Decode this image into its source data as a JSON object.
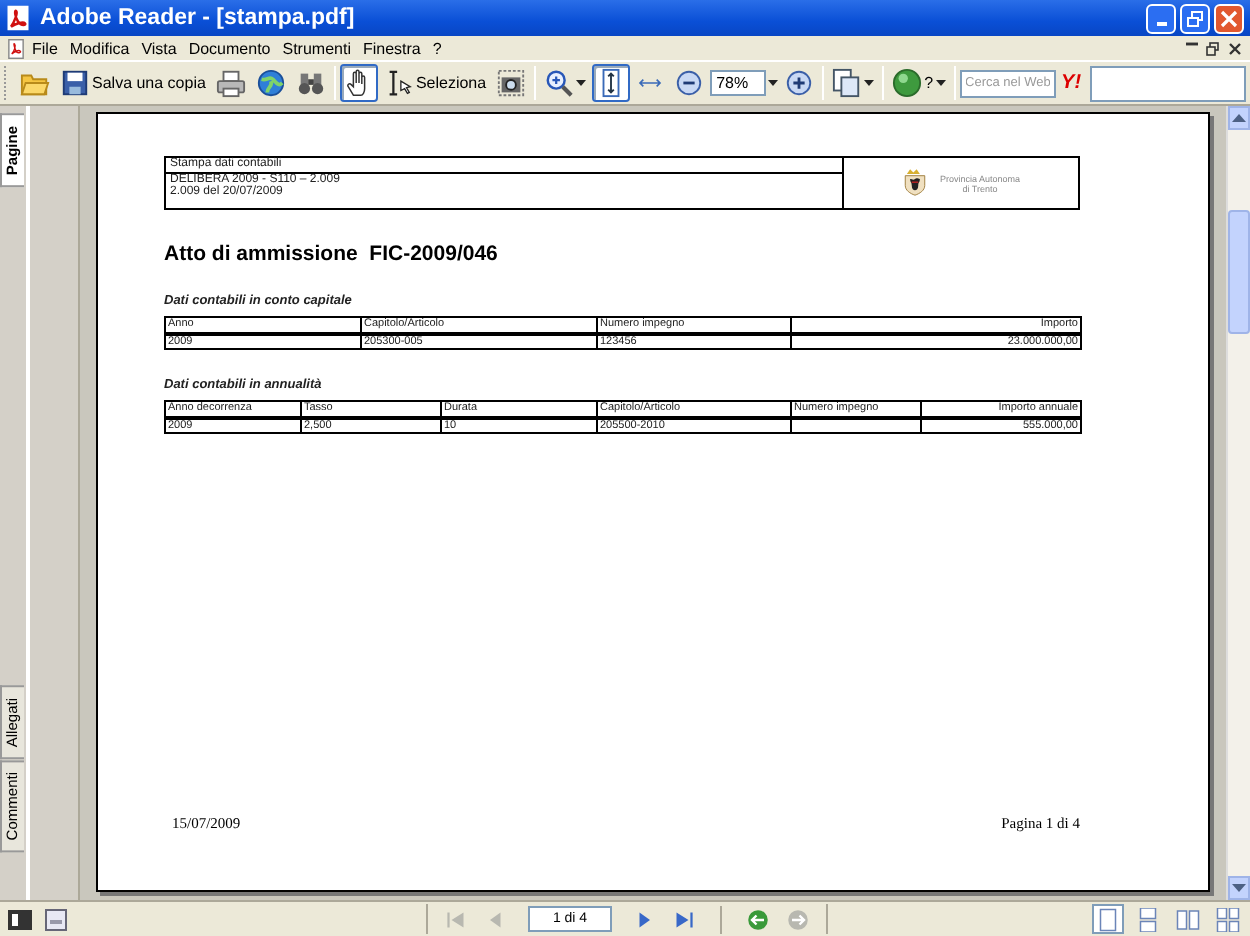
{
  "window": {
    "title": "Adobe Reader - [stampa.pdf]"
  },
  "menu": [
    "File",
    "Modifica",
    "Vista",
    "Documento",
    "Strumenti",
    "Finestra",
    "?"
  ],
  "toolbar": [
    [
      {
        "kind": "open",
        "pressed": false,
        "dropdown": false
      },
      {
        "kind": "save",
        "label": "Salva una copia",
        "pressed": false,
        "dropdown": false
      },
      {
        "kind": "print",
        "pressed": false,
        "dropdown": false
      },
      {
        "kind": "web",
        "pressed": false,
        "dropdown": false
      },
      {
        "kind": "find",
        "pressed": false,
        "dropdown": false
      }
    ],
    [
      {
        "kind": "hand",
        "pressed": true,
        "dropdown": false
      },
      {
        "kind": "select",
        "label": "Seleziona",
        "pressed": false,
        "dropdown": false
      },
      {
        "kind": "snapshot",
        "pressed": false,
        "dropdown": false
      }
    ],
    [
      {
        "kind": "zoomtool",
        "pressed": false,
        "dropdown": true
      },
      {
        "kind": "fitpage",
        "pressed": true,
        "dropdown": false
      },
      {
        "kind": "fitwidth",
        "pressed": false,
        "dropdown": false
      },
      {
        "kind": "zoomout",
        "pressed": false,
        "dropdown": false
      },
      {
        "kind": "zoom",
        "value": "78%",
        "dropdown": true
      },
      {
        "kind": "zoomin",
        "pressed": false,
        "dropdown": false
      }
    ],
    [
      {
        "kind": "pages",
        "pressed": false,
        "dropdown": true
      }
    ],
    [
      {
        "kind": "help",
        "label": "?",
        "pressed": false,
        "dropdown": true
      }
    ],
    [
      {
        "kind": "search",
        "placeholder": "Cerca nel Web"
      },
      {
        "kind": "yahoo",
        "label": "Y!",
        "pressed": false,
        "dropdown": false
      }
    ]
  ],
  "side_tabs_top": [
    {
      "label": "Pagine",
      "selected": true
    }
  ],
  "side_tabs_bottom": [
    {
      "label": "Allegati",
      "selected": false
    },
    {
      "label": "Commenti",
      "selected": false
    }
  ],
  "document": {
    "header": {
      "caption": "Stampa dati contabili",
      "lines": [
        "DELIBERA 2009 - S110 – 2.009",
        "2.009 del 20/07/2009"
      ],
      "logo_text": [
        "Provincia Autonoma",
        "di Trento"
      ]
    },
    "title": "Atto di ammissione  FIC-2009/046",
    "sections": [
      {
        "heading": "Dati contabili in conto capitale",
        "columns": [
          "Anno",
          "Capitolo/Articolo",
          "Numero impegno",
          "Importo"
        ],
        "rows": [
          [
            "2009",
            "205300-005",
            "123456",
            "23.000.000,00"
          ]
        ]
      },
      {
        "heading": "Dati contabili in annualità",
        "columns": [
          "Anno decorrenza",
          "Tasso",
          "Durata",
          "Capitolo/Articolo",
          "Numero impegno",
          "Importo annuale"
        ],
        "rows": [
          [
            "2009",
            "2,500",
            "10",
            "205500-2010",
            null,
            "555.000,00"
          ]
        ]
      }
    ],
    "footer": {
      "date": "15/07/2009",
      "page": "Pagina 1 di 4"
    }
  },
  "statusbar": {
    "nav_before": [
      {
        "kind": "first",
        "disabled": true
      },
      {
        "kind": "prev",
        "disabled": true
      }
    ],
    "page": "1 di 4",
    "nav_after": [
      {
        "kind": "next",
        "disabled": false
      },
      {
        "kind": "last",
        "disabled": false
      },
      {
        "kind": "back",
        "disabled": false
      },
      {
        "kind": "forward",
        "disabled": true
      }
    ],
    "layouts": [
      {
        "kind": "single",
        "selected": true
      },
      {
        "kind": "continuous",
        "selected": false
      },
      {
        "kind": "facing",
        "selected": false
      },
      {
        "kind": "continuous-facing",
        "selected": false
      }
    ]
  }
}
